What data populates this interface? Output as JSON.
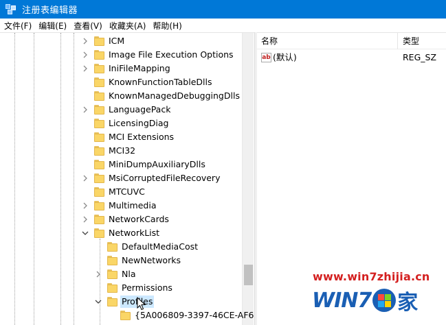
{
  "window": {
    "title": "注册表编辑器",
    "icon": "registry-editor-icon"
  },
  "menu": [
    "文件(F)",
    "编辑(E)",
    "查看(V)",
    "收藏夹(A)",
    "帮助(H)"
  ],
  "tree": {
    "items": [
      {
        "label": "ICM",
        "expander": "collapsed"
      },
      {
        "label": "Image File Execution Options",
        "expander": "collapsed"
      },
      {
        "label": "IniFileMapping",
        "expander": "collapsed"
      },
      {
        "label": "KnownFunctionTableDlls",
        "expander": "none"
      },
      {
        "label": "KnownManagedDebuggingDlls",
        "expander": "none"
      },
      {
        "label": "LanguagePack",
        "expander": "collapsed"
      },
      {
        "label": "LicensingDiag",
        "expander": "none"
      },
      {
        "label": "MCI Extensions",
        "expander": "none"
      },
      {
        "label": "MCI32",
        "expander": "none"
      },
      {
        "label": "MiniDumpAuxiliaryDlls",
        "expander": "none"
      },
      {
        "label": "MsiCorruptedFileRecovery",
        "expander": "collapsed"
      },
      {
        "label": "MTCUVC",
        "expander": "none"
      },
      {
        "label": "Multimedia",
        "expander": "collapsed"
      },
      {
        "label": "NetworkCards",
        "expander": "collapsed"
      },
      {
        "label": "NetworkList",
        "expander": "expanded"
      },
      {
        "label": "DefaultMediaCost",
        "expander": "none"
      },
      {
        "label": "NewNetworks",
        "expander": "none"
      },
      {
        "label": "Nla",
        "expander": "collapsed"
      },
      {
        "label": "Permissions",
        "expander": "none"
      },
      {
        "label": "Profiles",
        "expander": "expanded",
        "selected": true
      },
      {
        "label": "{5A006809-3397-46CE-AF6",
        "expander": "none"
      }
    ]
  },
  "list": {
    "columns": {
      "name": "名称",
      "type": "类型"
    },
    "rows": [
      {
        "name": "(默认)",
        "type": "REG_SZ",
        "icon": "string-value-icon"
      }
    ]
  },
  "watermark": {
    "url": "www.win7zhijia.cn",
    "logo_text": "WIN7",
    "logo_suffix": "家"
  },
  "icons": {
    "folder": "folder-icon",
    "chevron_right": "chevron-right-icon",
    "chevron_down": "chevron-down-icon",
    "cursor": "mouse-pointer-icon"
  },
  "colors": {
    "titlebar": "#0078d7",
    "selection": "#cce8ff",
    "folder": "#fad667",
    "watermark_red": "#d42020",
    "watermark_blue": "#1a5fb4"
  }
}
